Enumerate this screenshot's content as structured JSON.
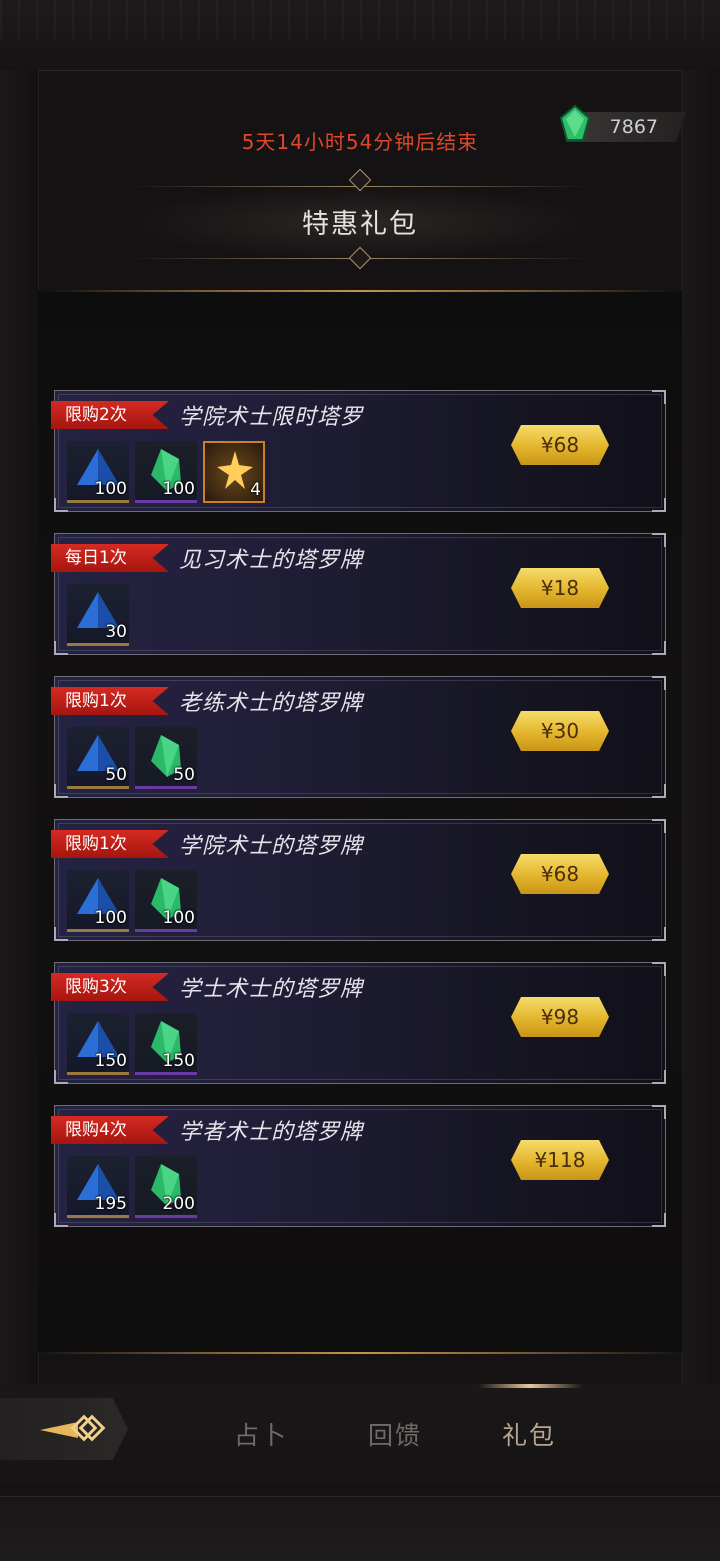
{
  "header": {
    "timer": "5天14小时54分钟后结束",
    "currency_value": "7867",
    "title": "特惠礼包"
  },
  "packages": [
    {
      "badge": "限购2次",
      "name": "学院术士限时塔罗",
      "price": "¥68",
      "items": [
        {
          "icon": "blue-pyramid-icon",
          "qty": "100"
        },
        {
          "icon": "green-gem-icon",
          "qty": "100"
        },
        {
          "icon": "tarot-card-icon",
          "qty": "4"
        }
      ]
    },
    {
      "badge": "每日1次",
      "name": "见习术士的塔罗牌",
      "price": "¥18",
      "items": [
        {
          "icon": "blue-pyramid-icon",
          "qty": "30"
        }
      ]
    },
    {
      "badge": "限购1次",
      "name": "老练术士的塔罗牌",
      "price": "¥30",
      "items": [
        {
          "icon": "blue-pyramid-icon",
          "qty": "50"
        },
        {
          "icon": "green-gem-icon",
          "qty": "50"
        }
      ]
    },
    {
      "badge": "限购1次",
      "name": "学院术士的塔罗牌",
      "price": "¥68",
      "items": [
        {
          "icon": "blue-pyramid-icon",
          "qty": "100"
        },
        {
          "icon": "green-gem-icon",
          "qty": "100"
        }
      ]
    },
    {
      "badge": "限购3次",
      "name": "学士术士的塔罗牌",
      "price": "¥98",
      "items": [
        {
          "icon": "blue-pyramid-icon",
          "qty": "150"
        },
        {
          "icon": "green-gem-icon",
          "qty": "150"
        }
      ]
    },
    {
      "badge": "限购4次",
      "name": "学者术士的塔罗牌",
      "price": "¥118",
      "items": [
        {
          "icon": "blue-pyramid-icon",
          "qty": "195"
        },
        {
          "icon": "green-gem-icon",
          "qty": "200"
        }
      ]
    }
  ],
  "tabs": [
    "占卜",
    "回馈",
    "礼包"
  ],
  "active_tab": "礼包",
  "colors": {
    "timer": "#e0462b",
    "badge": "#c8201a",
    "price": "#e8b830",
    "accent": "#c6934e"
  }
}
